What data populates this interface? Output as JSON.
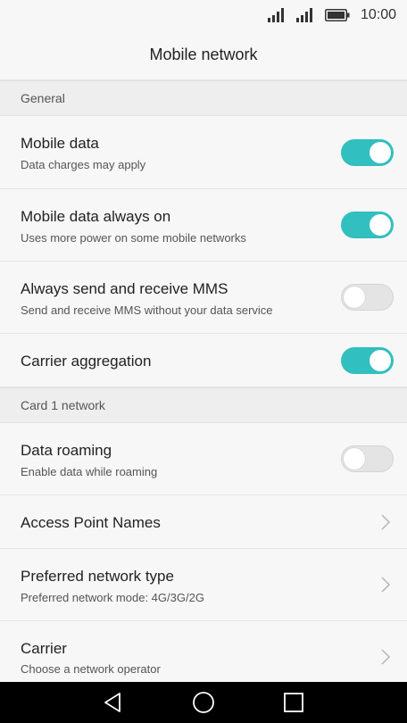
{
  "status_bar": {
    "time": "10:00",
    "icons": [
      "signal-icon",
      "signal-icon",
      "battery-icon"
    ]
  },
  "header": {
    "title": "Mobile network"
  },
  "sections": {
    "general": "General",
    "card1": "Card 1 network"
  },
  "settings": {
    "mobile_data": {
      "title": "Mobile data",
      "subtitle": "Data charges may apply",
      "enabled": true
    },
    "mobile_data_always_on": {
      "title": "Mobile data always on",
      "subtitle": "Uses more power on some mobile networks",
      "enabled": true
    },
    "always_mms": {
      "title": "Always send and receive MMS",
      "subtitle": "Send and receive MMS without your data service",
      "enabled": false
    },
    "carrier_aggregation": {
      "title": "Carrier aggregation",
      "enabled": true
    },
    "data_roaming": {
      "title": "Data roaming",
      "subtitle": "Enable data while roaming",
      "enabled": false
    },
    "apn": {
      "title": "Access Point Names"
    },
    "preferred_network": {
      "title": "Preferred network type",
      "subtitle": "Preferred network mode: 4G/3G/2G"
    },
    "carrier": {
      "title": "Carrier",
      "subtitle": "Choose a network operator"
    }
  },
  "nav_bar": {
    "buttons": [
      "back-icon",
      "home-icon",
      "recents-icon"
    ]
  },
  "colors": {
    "accent": "#31bfbf",
    "toggle_off": "#e4e4e4",
    "background": "#f7f7f7",
    "section_header": "#eeeeee",
    "nav_bar": "#000000"
  }
}
